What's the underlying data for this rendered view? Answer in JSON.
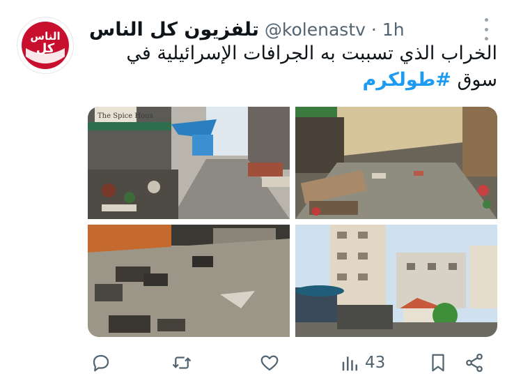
{
  "tweet": {
    "display_name": "تلفزيون كل الناس",
    "handle": "@kolenastv",
    "separator": "·",
    "time": "1h",
    "text_line1": "الخراب الذي تسببت به الجرافات الإسرائيلية في",
    "text_line2_prefix": "سوق ",
    "hashtag": "#طولكرم",
    "avatar_text_top": "الناس",
    "avatar_text_bottom": "كل",
    "photo1_sign": "The Spice Hous",
    "views": "43"
  },
  "icons": {
    "more": "more-options-icon",
    "reply": "reply-icon",
    "retweet": "retweet-icon",
    "like": "like-icon",
    "views": "views-icon",
    "bookmark": "bookmark-icon",
    "share": "share-icon"
  },
  "colors": {
    "accent": "#1d9bf0",
    "muted": "#536471",
    "avatar_red": "#c8102e"
  }
}
